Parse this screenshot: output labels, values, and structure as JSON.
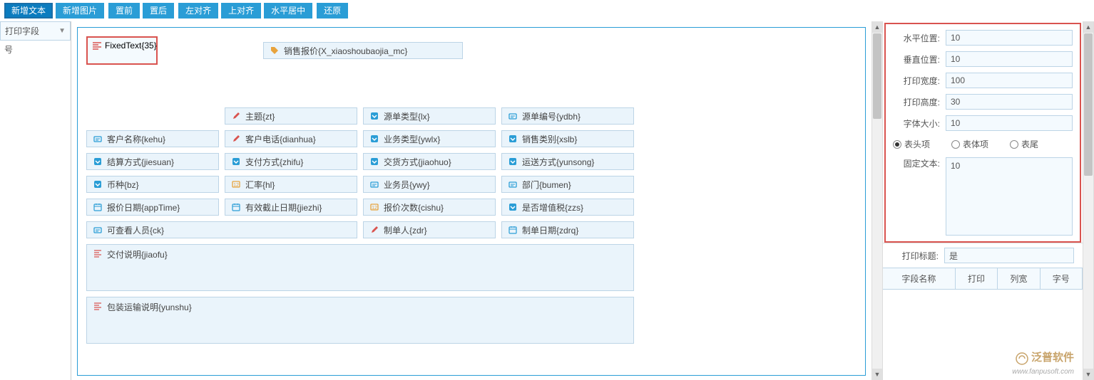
{
  "toolbar": {
    "add_text": "新增文本",
    "add_image": "新增图片",
    "bring_front": "置前",
    "send_back": "置后",
    "align_left": "左对齐",
    "align_top": "上对齐",
    "align_center_h": "水平居中",
    "reset": "还原"
  },
  "left_panel": {
    "header": "打印字段",
    "item": "号"
  },
  "canvas": {
    "selected": {
      "label": "FixedText{35}"
    },
    "title": "销售报价{X_xiaoshoubaojia_mc}",
    "rows": [
      [
        {
          "icon": "empty",
          "label": ""
        },
        {
          "icon": "edit",
          "label": "主题{zt}"
        },
        {
          "icon": "dd",
          "label": "源单类型{lx}"
        },
        {
          "icon": "link",
          "label": "源单编号{ydbh}"
        }
      ],
      [
        {
          "icon": "link",
          "label": "客户名称{kehu}"
        },
        {
          "icon": "edit",
          "label": "客户电话{dianhua}"
        },
        {
          "icon": "dd",
          "label": "业务类型{ywlx}"
        },
        {
          "icon": "dd",
          "label": "销售类别{xslb}"
        }
      ],
      [
        {
          "icon": "dd",
          "label": "结算方式{jiesuan}"
        },
        {
          "icon": "dd",
          "label": "支付方式{zhifu}"
        },
        {
          "icon": "dd",
          "label": "交货方式{jiaohuo}"
        },
        {
          "icon": "dd",
          "label": "运送方式{yunsong}"
        }
      ],
      [
        {
          "icon": "dd",
          "label": "币种{bz}"
        },
        {
          "icon": "num",
          "label": "汇率{hl}"
        },
        {
          "icon": "link",
          "label": "业务员{ywy}"
        },
        {
          "icon": "link",
          "label": "部门{bumen}"
        }
      ],
      [
        {
          "icon": "cal",
          "label": "报价日期{appTime}"
        },
        {
          "icon": "cal",
          "label": "有效截止日期{jiezhi}"
        },
        {
          "icon": "num",
          "label": "报价次数{cishu}"
        },
        {
          "icon": "dd",
          "label": "是否增值税{zzs}"
        }
      ],
      [
        {
          "icon": "link",
          "label": "可查看人员{ck}",
          "span": 2
        },
        {
          "icon": "edit",
          "label": "制单人{zdr}"
        },
        {
          "icon": "cal",
          "label": "制单日期{zdrq}"
        }
      ],
      [
        {
          "icon": "para",
          "label": "交付说明{jiaofu}",
          "span": 4,
          "tall": true
        }
      ],
      [
        {
          "icon": "para",
          "label": "包装运输说明{yunshu}",
          "span": 4,
          "tall": true
        }
      ]
    ]
  },
  "properties": {
    "labels": {
      "h_pos": "水平位置:",
      "v_pos": "垂直位置:",
      "print_w": "打印宽度:",
      "print_h": "打印高度:",
      "font_size": "字体大小:",
      "fixed_text": "固定文本:",
      "print_title": "打印标题:"
    },
    "values": {
      "h_pos": "10",
      "v_pos": "10",
      "print_w": "100",
      "print_h": "30",
      "font_size": "10",
      "fixed_text": "10",
      "print_title": "是"
    },
    "radio": {
      "header_item": "表头项",
      "body_item": "表体项",
      "footer_item": "表尾"
    }
  },
  "table_header": {
    "col1": "字段名称",
    "col2": "打印",
    "col3": "列宽",
    "col4": "字号"
  },
  "brand": {
    "name": "泛普软件",
    "url": "www.fanpusoft.com"
  }
}
